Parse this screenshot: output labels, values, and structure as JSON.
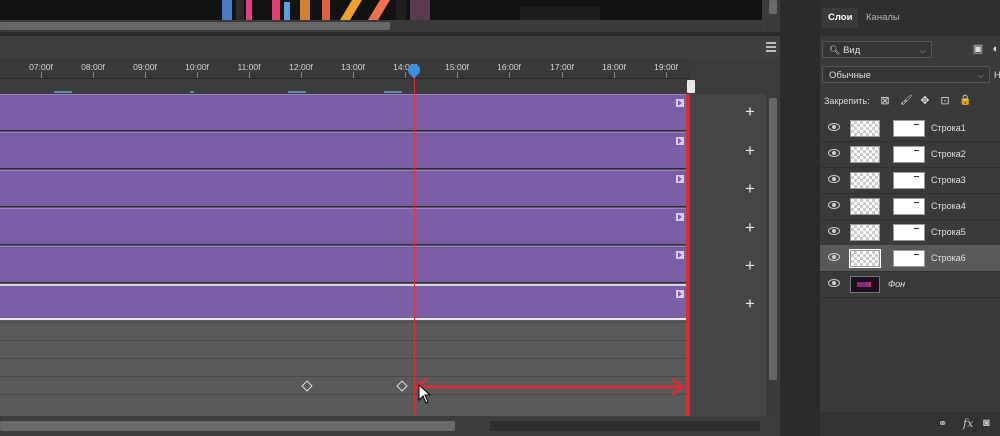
{
  "timeline": {
    "ruler_ticks": [
      "07:00f",
      "08:00f",
      "09:00f",
      "10:00f",
      "11:00f",
      "12:00f",
      "13:00f",
      "14:00f",
      "15:00f",
      "16:00f",
      "17:00f",
      "18:00f",
      "19:00f"
    ],
    "tracks": 6,
    "add_labels": [
      "+",
      "+",
      "+",
      "+",
      "+",
      "+"
    ]
  },
  "layers_panel": {
    "tabs": [
      "Слои",
      "Каналы"
    ],
    "filter": {
      "label": "Вид"
    },
    "blend_mode": "Обычные",
    "opacity_label": "Н",
    "lock_label": "Закрепить:",
    "lock_icons": [
      "⊠",
      "🖌",
      "✥",
      "⊡",
      "🔒"
    ],
    "layers": [
      {
        "name": "Строка1",
        "selected": false
      },
      {
        "name": "Строка2",
        "selected": false
      },
      {
        "name": "Строка3",
        "selected": false
      },
      {
        "name": "Строка4",
        "selected": false
      },
      {
        "name": "Строка5",
        "selected": false
      },
      {
        "name": "Строка6",
        "selected": true
      }
    ],
    "background_layer": "Фон",
    "bottom_icons": [
      "link-icon",
      "fx",
      "mask-icon"
    ],
    "fx_label": "fx"
  },
  "colors": {
    "track": "#7b5ea6",
    "playhead": "#e1303a",
    "annotation": "#d62e36",
    "handle": "#3d8fe0"
  }
}
